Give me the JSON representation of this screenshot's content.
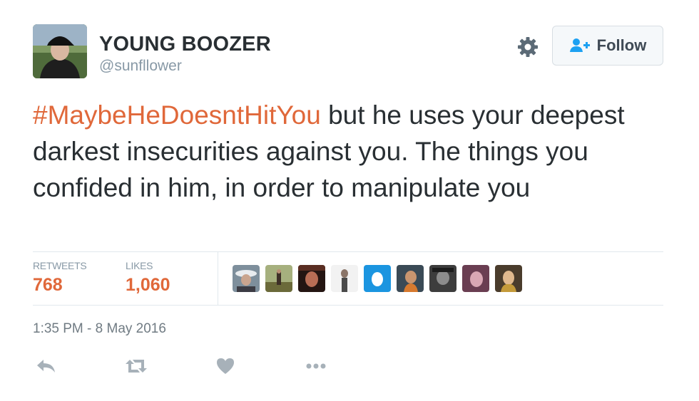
{
  "author": {
    "display_name": "YOUNG BOOZER",
    "handle": "@sunfllower"
  },
  "follow_button": {
    "label": "Follow"
  },
  "tweet": {
    "hashtag": "#MaybeHeDoesntHitYou",
    "text": " but he uses your deepest darkest insecurities against you. The things you confided in him, in order to manipulate you"
  },
  "stats": {
    "retweets_label": "RETWEETS",
    "retweets_count": "768",
    "likes_label": "LIKES",
    "likes_count": "1,060"
  },
  "timestamp": "1:35 PM - 8 May 2016",
  "colors": {
    "accent": "#e0683a",
    "text": "#292f33",
    "muted": "#8899a6",
    "icon": "#a7b1b9"
  },
  "icons": [
    "gear-icon",
    "add-user-icon",
    "reply-icon",
    "retweet-icon",
    "like-icon",
    "more-icon"
  ]
}
